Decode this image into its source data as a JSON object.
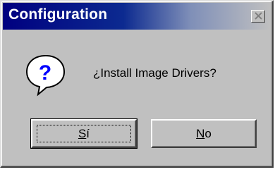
{
  "window": {
    "title": "Configuration",
    "close_icon": "close-icon"
  },
  "dialog": {
    "icon": "question-icon",
    "message": "¿Install Image Drivers?"
  },
  "buttons": {
    "yes": {
      "mnemonic": "S",
      "rest": "í",
      "label": "Sí"
    },
    "no": {
      "mnemonic": "N",
      "rest": "o",
      "label": "No"
    }
  },
  "colors": {
    "titlebar_start": "#000080",
    "face": "#c0c0c0",
    "icon_blue": "#0000ff"
  }
}
